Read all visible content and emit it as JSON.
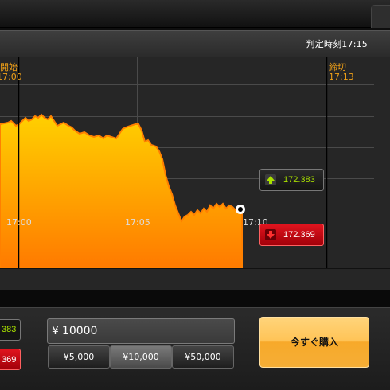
{
  "header": {
    "judge_time": "判定時刻17:15"
  },
  "chart": {
    "start_marker": {
      "label": "開始",
      "time": "17:00"
    },
    "end_marker": {
      "label": "締切",
      "time": "17:13"
    },
    "time_labels": [
      "17:00",
      "17:05",
      "17:10"
    ],
    "colors": {
      "fill_top": "#ffd000",
      "fill_bottom": "#ff7a00",
      "line": "#ff8c00",
      "marker": "#f0a017"
    }
  },
  "quotes": {
    "high_price": "172.383",
    "low_price": "172.369",
    "high_icon": "up-arrow-icon",
    "low_icon": "down-arrow-icon"
  },
  "order": {
    "mini_high": "383",
    "mini_low": "369",
    "currency": "¥",
    "amount": "10000",
    "presets": [
      "¥5,000",
      "¥10,000",
      "¥50,000"
    ],
    "selected_preset": "¥10,000",
    "buy_label": "今すぐ購入"
  }
}
